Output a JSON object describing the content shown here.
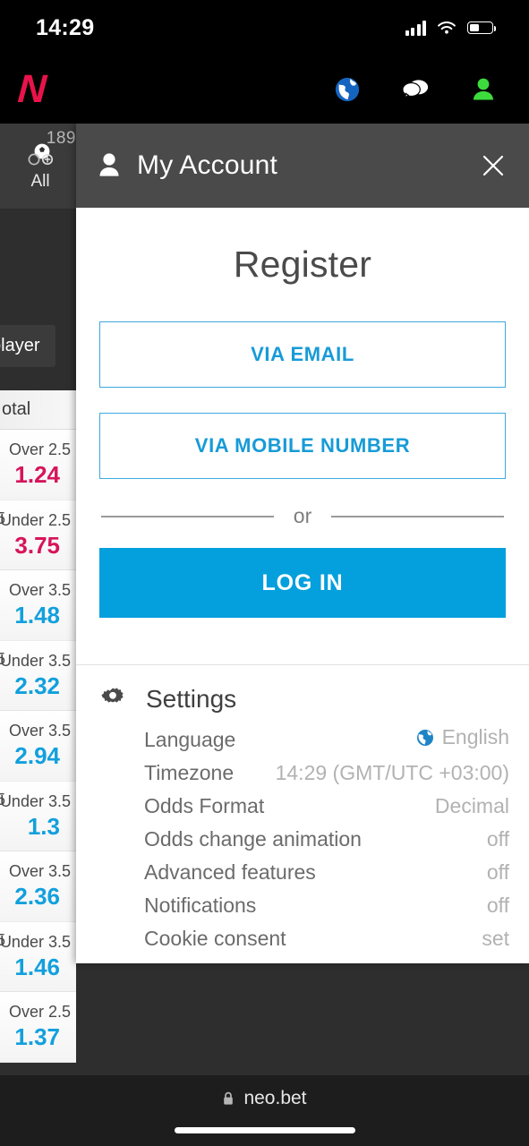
{
  "status_bar": {
    "time": "14:29",
    "signal_icon": "cellular-bars-icon",
    "wifi_icon": "wifi-icon",
    "battery_icon": "battery-icon"
  },
  "app_bar": {
    "logo": "N",
    "logo_color": "#e8134a",
    "icons": [
      {
        "name": "globe-icon",
        "label": "Language"
      },
      {
        "name": "chat-icon",
        "label": "Chat"
      },
      {
        "name": "account-icon",
        "label": "My Account"
      }
    ]
  },
  "sidebar": {
    "sport_tab": {
      "badge": "189",
      "label": "All",
      "icon": "soccer-ball-icon"
    },
    "chip_label": "player",
    "odds_header": "otal",
    "odds_groups": [
      {
        "rows": [
          {
            "prefix": "",
            "name": "Over 2.5",
            "value": "1.24",
            "color": "red"
          },
          {
            "prefix": "5",
            "name": "Under 2.5",
            "value": "3.75",
            "color": "red"
          }
        ]
      },
      {
        "rows": [
          {
            "prefix": "",
            "name": "Over 3.5",
            "value": "1.48",
            "color": "blue"
          },
          {
            "prefix": "5",
            "name": "Under 3.5",
            "value": "2.32",
            "color": "blue"
          }
        ]
      },
      {
        "rows": [
          {
            "prefix": "",
            "name": "Over 3.5",
            "value": "2.94",
            "color": "blue"
          },
          {
            "prefix": "5",
            "name": "Under 3.5",
            "value": "1.3",
            "color": "blue"
          }
        ]
      },
      {
        "rows": [
          {
            "prefix": "",
            "name": "Over 3.5",
            "value": "2.36",
            "color": "blue"
          },
          {
            "prefix": "5",
            "name": "Under 3.5",
            "value": "1.46",
            "color": "blue"
          }
        ]
      },
      {
        "rows": [
          {
            "prefix": "",
            "name": "Over 2.5",
            "value": "1.37",
            "color": "blue"
          }
        ]
      }
    ]
  },
  "modal": {
    "title": "My Account",
    "title_icon": "person-icon",
    "close_icon": "close-icon",
    "register": {
      "heading": "Register",
      "via_email_label": "VIA EMAIL",
      "via_mobile_label": "VIA MOBILE NUMBER",
      "divider_text": "or",
      "login_label": "LOG IN"
    },
    "settings": {
      "heading": "Settings",
      "heading_icon": "gear-icon",
      "rows": [
        {
          "label": "Language",
          "value": "English",
          "icon": "globe-icon"
        },
        {
          "label": "Timezone",
          "value": "14:29 (GMT/UTC +03:00)",
          "icon": ""
        },
        {
          "label": "Odds Format",
          "value": "Decimal",
          "icon": ""
        },
        {
          "label": "Odds change animation",
          "value": "off",
          "icon": ""
        },
        {
          "label": "Advanced features",
          "value": "off",
          "icon": ""
        },
        {
          "label": "Notifications",
          "value": "off",
          "icon": ""
        },
        {
          "label": "Cookie consent",
          "value": "set",
          "icon": ""
        }
      ]
    }
  },
  "browser": {
    "url": "neo.bet",
    "lock_icon": "lock-icon"
  },
  "colors": {
    "accent_blue": "#049fdd",
    "outline_blue": "#3ea9dd",
    "brand_red": "#e8134a",
    "odds_red": "#d6155a",
    "odds_blue": "#12a0dd",
    "modal_header": "#4a4a4a",
    "page_dark": "#2e2e2e"
  }
}
